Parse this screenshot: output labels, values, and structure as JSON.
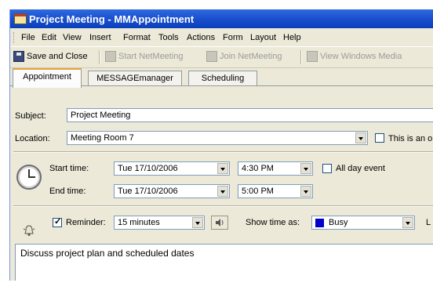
{
  "window": {
    "title": "Project Meeting - MMAppointment"
  },
  "menu": [
    "File",
    "Edit",
    "View",
    "Insert",
    "Format",
    "Tools",
    "Actions",
    "Form",
    "Layout",
    "Help"
  ],
  "toolbar": {
    "save_close": "Save and Close",
    "start_netmeeting": "Start NetMeeting",
    "join_netmeeting": "Join NetMeeting",
    "view_media": "View Windows Media"
  },
  "tabs": [
    "Appointment",
    "MESSAGEmanager",
    "Scheduling"
  ],
  "form": {
    "subject_label": "Subject:",
    "subject_value": "Project Meeting",
    "location_label": "Location:",
    "location_value": "Meeting Room 7",
    "online_label": "This is an o",
    "start_label": "Start time:",
    "start_date": "Tue 17/10/2006",
    "start_time": "4:30 PM",
    "end_label": "End time:",
    "end_date": "Tue 17/10/2006",
    "end_time": "5:00 PM",
    "all_day_label": "All day event",
    "reminder_label": "Reminder:",
    "reminder_checked": true,
    "reminder_value": "15 minutes",
    "show_time_label": "Show time as:",
    "show_time_value": "Busy",
    "show_time_color": "#0000c8",
    "cut_label": "L"
  },
  "notes": "Discuss project plan and scheduled dates"
}
